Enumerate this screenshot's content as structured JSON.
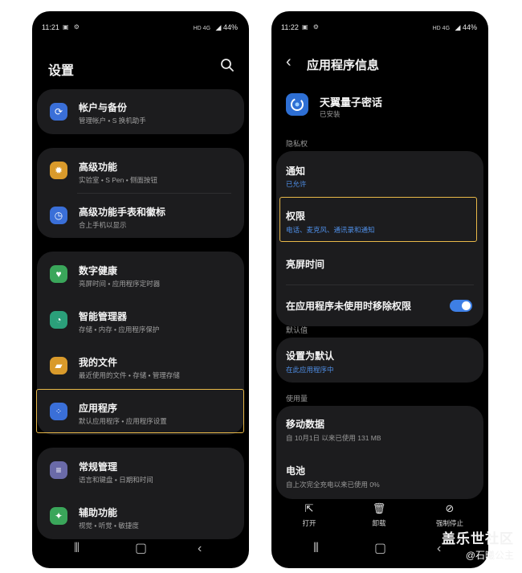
{
  "left": {
    "status": {
      "time": "11:21",
      "network": "HD 4G",
      "battery": "44%"
    },
    "header": {
      "title": "设置"
    },
    "groups": [
      {
        "items": [
          {
            "title": "帐户与备份",
            "subtitle": "管理帐户 • S 换机助手",
            "icon": "sync-icon",
            "color": "#3a6fd8"
          }
        ]
      },
      {
        "items": [
          {
            "title": "高级功能",
            "subtitle": "实验室 • S Pen • 侧面按钮",
            "icon": "gear-plus-icon",
            "color": "#d99a2b"
          },
          {
            "title": "高级功能手表和徽标",
            "subtitle": "合上手机以显示",
            "icon": "watch-icon",
            "color": "#3a6fd8"
          }
        ]
      },
      {
        "items": [
          {
            "title": "数字健康",
            "subtitle": "亮屏时间 • 应用程序定时器",
            "icon": "heart-icon",
            "color": "#3aa65a"
          },
          {
            "title": "智能管理器",
            "subtitle": "存储 • 内存 • 应用程序保护",
            "icon": "gauge-icon",
            "color": "#2b9f7a"
          },
          {
            "title": "我的文件",
            "subtitle": "最近使用的文件 • 存储 • 管理存储",
            "icon": "folder-icon",
            "color": "#d99a2b"
          },
          {
            "title": "应用程序",
            "subtitle": "默认应用程序 • 应用程序设置",
            "icon": "apps-grid-icon",
            "color": "#3a6fd8"
          }
        ]
      },
      {
        "items": [
          {
            "title": "常规管理",
            "subtitle": "语言和键盘 • 日期和时间",
            "icon": "sliders-icon",
            "color": "#6a6aa8"
          },
          {
            "title": "辅助功能",
            "subtitle": "视觉 • 听觉 • 敏捷度",
            "icon": "accessibility-icon",
            "color": "#3aa65a"
          }
        ]
      }
    ]
  },
  "right": {
    "status": {
      "time": "11:22",
      "network": "HD 4G",
      "battery": "44%"
    },
    "header": {
      "title": "应用程序信息"
    },
    "app": {
      "name": "天翼量子密话",
      "status": "已安装"
    },
    "sections": {
      "privacy": "隐私权",
      "defaults": "默认值",
      "usage": "使用量"
    },
    "rows": {
      "notifications": {
        "title": "通知",
        "subtitle": "已允许"
      },
      "permissions": {
        "title": "权限",
        "subtitle": "电话、麦克风、通讯录和通知"
      },
      "screen_time": {
        "title": "亮屏时间"
      },
      "remove_perms": {
        "title": "在应用程序未使用时移除权限",
        "enabled": true
      },
      "set_default": {
        "title": "设置为默认",
        "subtitle": "在此应用程序中"
      },
      "mobile_data": {
        "title": "移动数据",
        "subtitle": "自 10月1日 以来已使用 131 MB"
      },
      "battery": {
        "title": "电池",
        "subtitle": "自上次完全充电以来已使用 0%"
      }
    },
    "actions": {
      "open": "打开",
      "uninstall": "卸载",
      "force_stop": "强制停止"
    }
  },
  "watermark": {
    "main": "盖乐世社区",
    "sub": "@石曦公主"
  },
  "colors": {
    "highlight": "#e9b949",
    "accent_blue": "#4f8fe8",
    "card": "#1c1c1e"
  }
}
